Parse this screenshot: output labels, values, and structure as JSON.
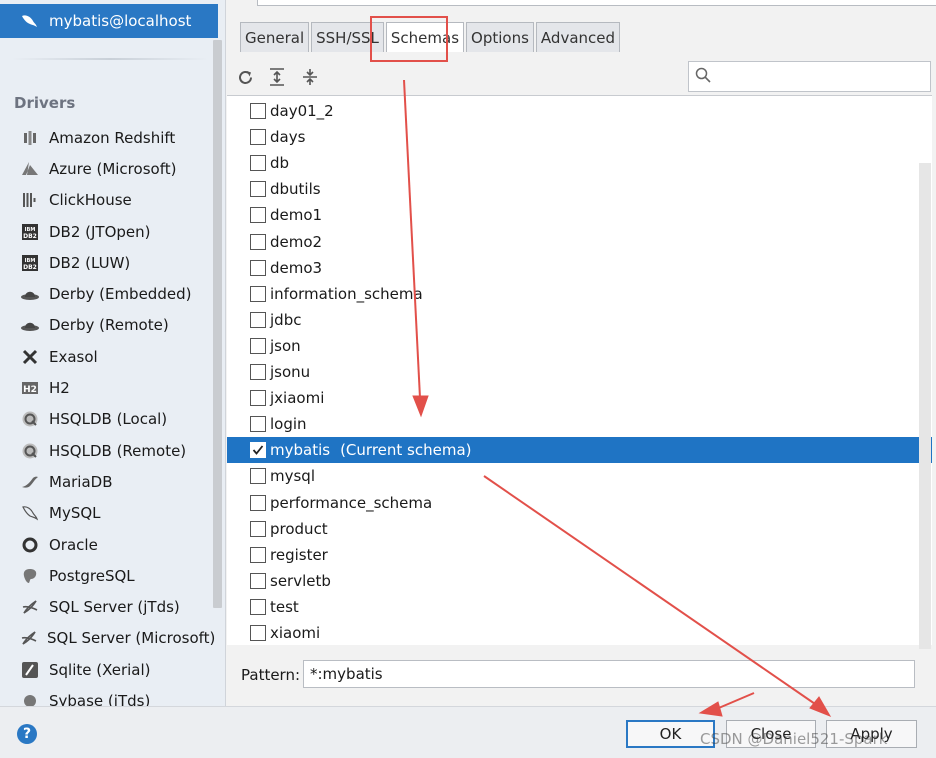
{
  "sidebar": {
    "selected_datasource": "mybatis@localhost",
    "section_title": "Drivers",
    "drivers": [
      {
        "label": "Amazon Redshift",
        "icon": "redshift-icon"
      },
      {
        "label": "Azure (Microsoft)",
        "icon": "azure-icon"
      },
      {
        "label": "ClickHouse",
        "icon": "clickhouse-icon"
      },
      {
        "label": "DB2 (JTOpen)",
        "icon": "db2-icon"
      },
      {
        "label": "DB2 (LUW)",
        "icon": "db2-icon"
      },
      {
        "label": "Derby (Embedded)",
        "icon": "derby-icon"
      },
      {
        "label": "Derby (Remote)",
        "icon": "derby-icon"
      },
      {
        "label": "Exasol",
        "icon": "exasol-icon"
      },
      {
        "label": "H2",
        "icon": "h2-icon"
      },
      {
        "label": "HSQLDB (Local)",
        "icon": "hsqldb-icon"
      },
      {
        "label": "HSQLDB (Remote)",
        "icon": "hsqldb-icon"
      },
      {
        "label": "MariaDB",
        "icon": "mariadb-icon"
      },
      {
        "label": "MySQL",
        "icon": "mysql-icon"
      },
      {
        "label": "Oracle",
        "icon": "oracle-icon"
      },
      {
        "label": "PostgreSQL",
        "icon": "postgresql-icon"
      },
      {
        "label": "SQL Server (jTds)",
        "icon": "sqlserver-icon"
      },
      {
        "label": "SQL Server (Microsoft)",
        "icon": "sqlserver-icon"
      },
      {
        "label": "Sqlite (Xerial)",
        "icon": "sqlite-icon"
      },
      {
        "label": "Sybase (jTds)",
        "icon": "sybase-icon"
      }
    ]
  },
  "tabs": [
    "General",
    "SSH/SSL",
    "Schemas",
    "Options",
    "Advanced"
  ],
  "active_tab": "Schemas",
  "toolbar": {
    "icons": [
      "refresh-icon",
      "expand-all-icon",
      "collapse-all-icon"
    ],
    "search_placeholder": ""
  },
  "schemas": [
    {
      "name": "day01_2",
      "checked": false
    },
    {
      "name": "days",
      "checked": false
    },
    {
      "name": "db",
      "checked": false
    },
    {
      "name": "dbutils",
      "checked": false
    },
    {
      "name": "demo1",
      "checked": false
    },
    {
      "name": "demo2",
      "checked": false
    },
    {
      "name": "demo3",
      "checked": false
    },
    {
      "name": "information_schema",
      "checked": false
    },
    {
      "name": "jdbc",
      "checked": false
    },
    {
      "name": "json",
      "checked": false
    },
    {
      "name": "jsonu",
      "checked": false
    },
    {
      "name": "jxiaomi",
      "checked": false
    },
    {
      "name": "login",
      "checked": false
    },
    {
      "name": "mybatis",
      "checked": true,
      "suffix": "(Current schema)",
      "selected": true
    },
    {
      "name": "mysql",
      "checked": false
    },
    {
      "name": "performance_schema",
      "checked": false
    },
    {
      "name": "product",
      "checked": false
    },
    {
      "name": "register",
      "checked": false
    },
    {
      "name": "servletb",
      "checked": false
    },
    {
      "name": "test",
      "checked": false
    },
    {
      "name": "xiaomi",
      "checked": false
    }
  ],
  "pattern": {
    "label": "Pattern:",
    "value": "*:mybatis"
  },
  "buttons": {
    "help": "?",
    "ok": "OK",
    "close": "Close",
    "apply": "Apply"
  },
  "watermark": "CSDN @Daniel521-Spark",
  "colors": {
    "accent": "#2a78c4",
    "selection": "#1f74c4",
    "annotation": "#e2504a"
  }
}
